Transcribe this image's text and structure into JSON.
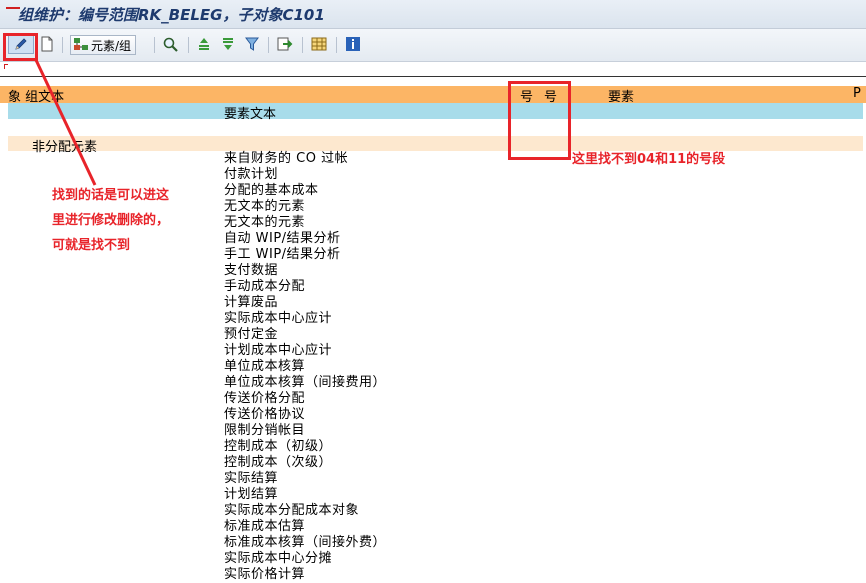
{
  "window": {
    "title": "组维护：编号范围RK_BELEG，子对象C101"
  },
  "toolbar": {
    "edit_icon": "pencil-icon",
    "new_icon": "blank-page-icon",
    "element_group_label": "元素/组",
    "element_group_icon": "element-group-icon",
    "find_icon": "magnifier-icon",
    "sort_asc_icon": "sort-ascending-icon",
    "sort_desc_icon": "sort-descending-icon",
    "filter_icon": "filter-icon",
    "export_icon": "export-icon",
    "layout_icon": "grid-layout-icon",
    "info_icon": "info-icon"
  },
  "table": {
    "header": {
      "object_group_text": "象 组文本",
      "number_col_1": "号",
      "number_col_2": "号",
      "element_col": "要素",
      "right_col": "P"
    },
    "subheader": {
      "element_text": "要素文本"
    },
    "group_label": "非分配元素",
    "rows": [
      "来自财务的 CO 过帐",
      "付款计划",
      "分配的基本成本",
      "无文本的元素",
      "无文本的元素",
      "自动 WIP/结果分析",
      "手工 WIP/结果分析",
      "支付数据",
      "手动成本分配",
      "计算废品",
      "实际成本中心应计",
      "预付定金",
      "计划成本中心应计",
      "单位成本核算",
      "单位成本核算（间接费用）",
      "传送价格分配",
      "传送价格协议",
      "限制分销帐目",
      "控制成本（初级）",
      "控制成本（次级）",
      "实际结算",
      "计划结算",
      "实际成本分配成本对象",
      "标准成本估算",
      "标准成本核算（间接外费）",
      "实际成本中心分摊",
      "实际价格计算"
    ]
  },
  "annotations": {
    "left_lines": [
      "找到的话是可以进这",
      "里进行修改删除的，",
      "可就是找不到"
    ],
    "right_note": "这里找不到04和11的号段",
    "color": "#e8242a"
  },
  "colors": {
    "header_orange": "#fcb565",
    "subheader_cyan": "#a8dcea",
    "group_beige": "#fde8cf"
  }
}
